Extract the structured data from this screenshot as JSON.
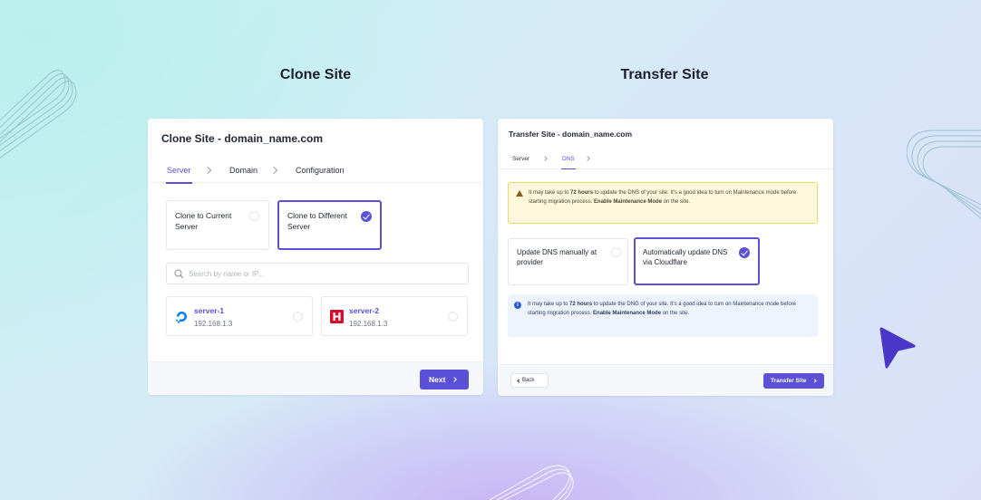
{
  "headings": {
    "clone": "Clone Site",
    "transfer": "Transfer Site"
  },
  "clone_card": {
    "title": "Clone Site - domain_name.com",
    "tabs": [
      "Server",
      "Domain",
      "Configuration"
    ],
    "active_tab": "Server",
    "options": [
      {
        "label_line1": "Clone to Current",
        "label_line2": "Server",
        "selected": false
      },
      {
        "label_line1": "Clone to Different",
        "label_line2": "Server",
        "selected": true
      }
    ],
    "search": {
      "placeholder": "Search by name or IP...",
      "value": ""
    },
    "servers": [
      {
        "name": "server-1",
        "ip": "192.168.1.3",
        "provider_icon": "digitalocean-icon"
      },
      {
        "name": "server-2",
        "ip": "192.168.1.3",
        "provider_icon": "hetzner-icon"
      }
    ],
    "next_label": "Next"
  },
  "transfer_card": {
    "title": "Transfer Site - domain_name.com",
    "tabs": [
      "Server",
      "DNS"
    ],
    "active_tab": "DNS",
    "warning": {
      "pre": "It may take up to ",
      "bold1": "72 hours",
      "mid": " to update the DNS of your site. It's a good idea to turn on Maintenance mode before starting migration process. ",
      "bold2": "Enable Maintenance Mode",
      "post": " on the site."
    },
    "options": [
      {
        "label_line1": "Update DNS manually at",
        "label_line2": "provider",
        "selected": false
      },
      {
        "label_line1": "Automatically update DNS",
        "label_line2": "via Cloudflare",
        "selected": true
      }
    ],
    "info": {
      "pre": "It may take up to ",
      "bold1": "72 hours",
      "mid": " to update the DNG of your site. It's a good idea to turn on Maintenance mode before starting migration process. ",
      "bold2": "Enable Maintenance Mode",
      "post": " on the site."
    },
    "back_label": "Back",
    "submit_label": "Transfer Site"
  },
  "colors": {
    "accent": "#5b50d6",
    "warning_bg": "#fdf7dc",
    "info_bg": "#eef4fd",
    "digitalocean": "#0080ff",
    "hetzner": "#d50c2d"
  }
}
